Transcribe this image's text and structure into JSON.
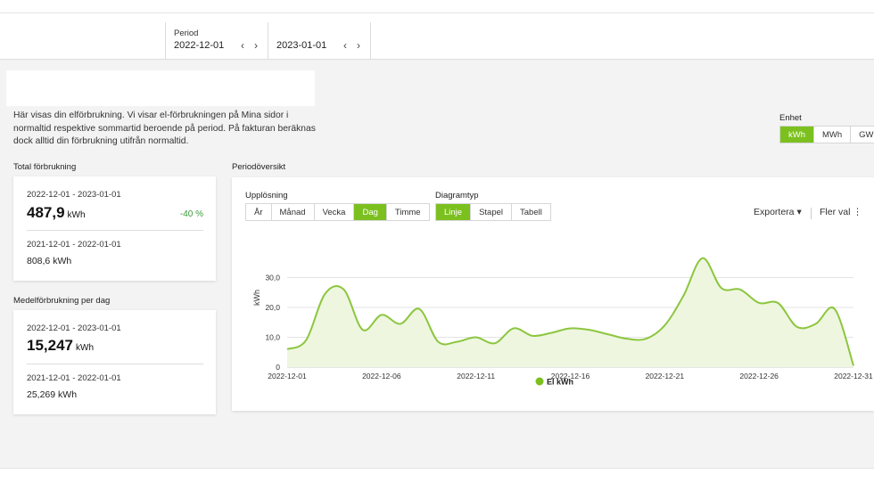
{
  "header": {
    "period_label": "Period",
    "start_date": "2022-12-01",
    "end_date": "2023-01-01",
    "prev_icon": "chevron-left-icon",
    "next_icon": "chevron-right-icon"
  },
  "intro_text": "Här visas din elförbrukning. Vi visar el-förbrukningen på Mina sidor i normaltid respektive sommartid beroende på period. På fakturan beräknas dock alltid din förbrukning utifrån normaltid.",
  "unit": {
    "label": "Enhet",
    "options": [
      "kWh",
      "MWh",
      "GWh"
    ],
    "selected": "kWh"
  },
  "total": {
    "title": "Total förbrukning",
    "current_range": "2022-12-01 - 2023-01-01",
    "current_value": "487,9",
    "current_unit": "kWh",
    "change": "-40 %",
    "previous_range": "2021-12-01 - 2022-01-01",
    "previous_value": "808,6 kWh"
  },
  "daily": {
    "title": "Medelförbrukning per dag",
    "current_range": "2022-12-01 - 2023-01-01",
    "current_value": "15,247",
    "current_unit": "kWh",
    "previous_range": "2021-12-01 - 2022-01-01",
    "previous_value": "25,269 kWh"
  },
  "overview": {
    "title": "Periodöversikt",
    "resolution_label": "Upplösning",
    "resolution_options": [
      "År",
      "Månad",
      "Vecka",
      "Dag",
      "Timme"
    ],
    "resolution_selected": "Dag",
    "chart_type_label": "Diagramtyp",
    "chart_type_options": [
      "Linje",
      "Stapel",
      "Tabell"
    ],
    "chart_type_selected": "Linje",
    "export_label": "Exportera",
    "more_label": "Fler val"
  },
  "colors": {
    "accent": "#7cc01f",
    "line": "#8cc63f",
    "fill": "#eef6df",
    "positive_change": "#3a9a3a"
  },
  "chart_data": {
    "type": "area",
    "ylabel": "kWh",
    "ylim": [
      0,
      36
    ],
    "yticks": [
      "0",
      "10,0",
      "20,0",
      "30,0"
    ],
    "x": [
      "2022-12-01",
      "2022-12-02",
      "2022-12-03",
      "2022-12-04",
      "2022-12-05",
      "2022-12-06",
      "2022-12-07",
      "2022-12-08",
      "2022-12-09",
      "2022-12-10",
      "2022-12-11",
      "2022-12-12",
      "2022-12-13",
      "2022-12-14",
      "2022-12-15",
      "2022-12-16",
      "2022-12-17",
      "2022-12-18",
      "2022-12-19",
      "2022-12-20",
      "2022-12-21",
      "2022-12-22",
      "2022-12-23",
      "2022-12-24",
      "2022-12-25",
      "2022-12-26",
      "2022-12-27",
      "2022-12-28",
      "2022-12-29",
      "2022-12-30",
      "2022-12-31"
    ],
    "xtick_labels": [
      "2022-12-01",
      "2022-12-06",
      "2022-12-11",
      "2022-12-16",
      "2022-12-21",
      "2022-12-26",
      "2022-12-31"
    ],
    "series": [
      {
        "name": "El kWh",
        "values": [
          6.0,
          9.0,
          24.5,
          26.0,
          12.5,
          17.5,
          14.5,
          19.5,
          8.5,
          8.5,
          10.0,
          8.0,
          13.0,
          10.5,
          11.5,
          13.0,
          12.5,
          11.0,
          9.5,
          9.5,
          14.0,
          24.0,
          36.5,
          26.5,
          26.0,
          21.5,
          21.5,
          13.5,
          14.5,
          19.5,
          0.5
        ]
      }
    ],
    "legend_position": "bottom",
    "grid": true
  }
}
